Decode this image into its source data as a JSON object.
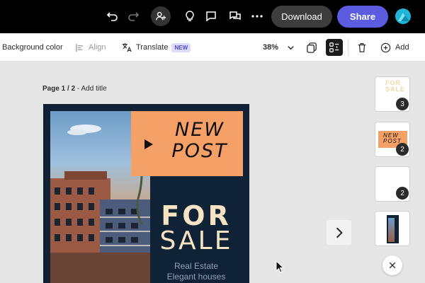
{
  "topbar": {
    "download_label": "Download",
    "share_label": "Share",
    "colors": {
      "bar": "#000000",
      "share": "#5c5ce0",
      "avatar": "#1fb5d6"
    },
    "icons": [
      "undo-icon",
      "redo-icon",
      "add-user-icon",
      "lightbulb-icon",
      "comment-icon",
      "chat-icon",
      "more-icon"
    ]
  },
  "toolbar": {
    "background_color_label": "Background color",
    "align_label": "Align",
    "translate_label": "Translate",
    "new_badge": "NEW",
    "zoom": "38%",
    "add_label": "Add"
  },
  "canvas": {
    "page_indicator": "Page 1 / 2",
    "separator": "-",
    "add_title": "Add title"
  },
  "poster": {
    "headline_line1": "NEW",
    "headline_line2": "POST",
    "for_text": "FOR",
    "sale_text": "SALE",
    "subtitle_line1": "Real Estate",
    "subtitle_line2": "Elegant houses",
    "colors": {
      "background": "#0f2236",
      "accent": "#f5a066",
      "title": "#f5e3c3"
    }
  },
  "thumbnails": [
    {
      "label": "FOR SALE",
      "count": "3"
    },
    {
      "label": "NEW POST",
      "count": "2"
    },
    {
      "label": "",
      "count": "2"
    },
    {
      "label": "",
      "count": ""
    }
  ]
}
